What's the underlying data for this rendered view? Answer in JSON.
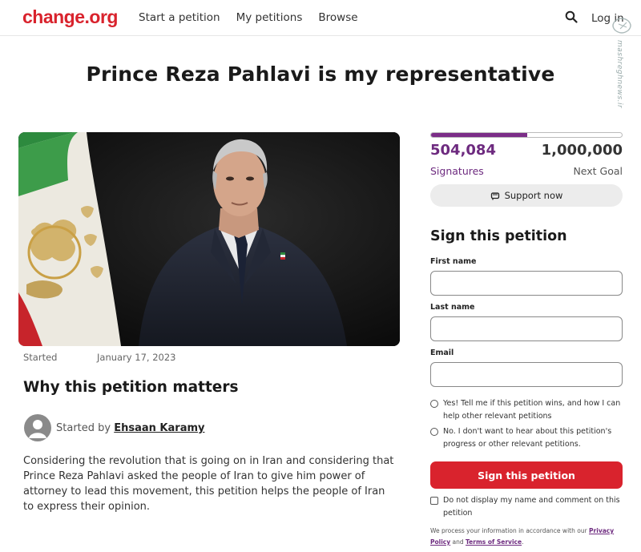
{
  "header": {
    "logo": "change.org",
    "nav": [
      "Start a petition",
      "My petitions",
      "Browse"
    ],
    "login": "Log in",
    "watermark": "mashreghnews.ir",
    "icons": [
      "search-icon"
    ]
  },
  "petition": {
    "title": "Prince Reza Pahlavi is my representative",
    "started_label": "Started",
    "started_date": "January 17, 2023",
    "why_heading": "Why this petition matters",
    "started_by_label": "Started by",
    "author": "Ehsaan Karamy",
    "body": "Considering the revolution that is going on in Iran and considering that Prince Reza Pahlavi asked the people of Iran to give him power of attorney to lead this movement, this petition helps the people of Iran to express their opinion."
  },
  "progress": {
    "signatures": "504,084",
    "signatures_label": "Signatures",
    "goal": "1,000,000",
    "goal_label": "Next Goal",
    "fraction": 0.504
  },
  "support": {
    "label": "Support now",
    "icon": "fist-icon"
  },
  "form": {
    "heading": "Sign this petition",
    "first_name_label": "First name",
    "first_name_value": "",
    "last_name_label": "Last name",
    "last_name_value": "",
    "email_label": "Email",
    "email_value": "",
    "option_yes": "Yes! Tell me if this petition wins, and how I can help other relevant petitions",
    "option_no": "No. I don't want to hear about this petition's progress or other relevant petitions.",
    "submit": "Sign this petition",
    "hide_name": "Do not display my name and comment on this petition",
    "privacy_prefix": "We process your information in accordance with our",
    "privacy_link": "Privacy Policy",
    "privacy_and": "and",
    "terms_link": "Terms of Service",
    "privacy_suffix": "."
  },
  "colors": {
    "brand_red": "#d9232d",
    "progress_purple": "#7b2d87"
  }
}
